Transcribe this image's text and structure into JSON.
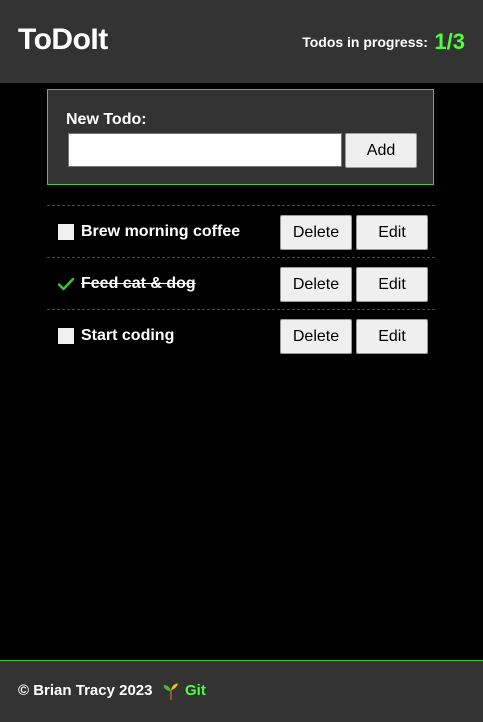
{
  "header": {
    "title": "ToDoIt",
    "progress_label": "Todos in progress:",
    "progress_count": "1/3"
  },
  "new_todo": {
    "label": "New Todo:",
    "input_value": "",
    "placeholder": "",
    "add_label": "Add"
  },
  "todos": [
    {
      "text": "Brew morning coffee",
      "done": false,
      "delete_label": "Delete",
      "edit_label": "Edit"
    },
    {
      "text": "Feed cat & dog",
      "done": true,
      "delete_label": "Delete",
      "edit_label": "Edit"
    },
    {
      "text": "Start coding",
      "done": false,
      "delete_label": "Delete",
      "edit_label": "Edit"
    }
  ],
  "footer": {
    "copyright": "© Brian Tracy 2023",
    "icon": "sprout-icon",
    "link_label": "Git"
  },
  "colors": {
    "accent": "#4CFF3A",
    "header_bg": "#333333",
    "page_bg": "#000000",
    "border_green": "#4CC63A"
  }
}
